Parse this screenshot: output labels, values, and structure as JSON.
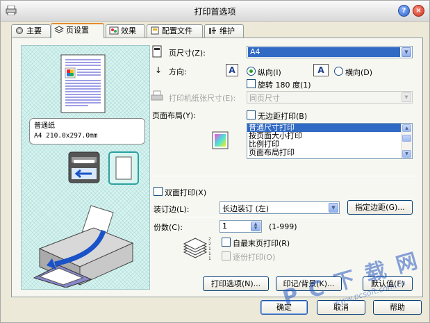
{
  "window": {
    "title": "打印首选项",
    "help_glyph": "?",
    "close_glyph": "×"
  },
  "tabs": [
    {
      "label": "主要",
      "active": false
    },
    {
      "label": "页设置",
      "active": true
    },
    {
      "label": "效果",
      "active": false
    },
    {
      "label": "配置文件",
      "active": false
    },
    {
      "label": "维护",
      "active": false
    }
  ],
  "preview": {
    "paper_name": "普通纸",
    "paper_size": "A4 210.0x297.0mm"
  },
  "page_size": {
    "label": "页尺寸(Z):",
    "value": "A4"
  },
  "orientation": {
    "label": "方向:",
    "portrait_label": "纵向(I)",
    "landscape_label": "横向(D)",
    "selected": "portrait",
    "rotate_label": "旋转 180 度(1)"
  },
  "printer_paper_size": {
    "label": "打印机纸张尺寸(E):",
    "value": "同页尺寸"
  },
  "page_layout": {
    "label": "页面布局(Y):",
    "borderless_label": "无边距打印(B)",
    "options": [
      "普通尺寸打印",
      "按页面大小打印",
      "比例打印",
      "页面布局打印"
    ],
    "selected_index": 0
  },
  "duplex": {
    "label": "双面打印(X)"
  },
  "binding": {
    "label": "装订边(L):",
    "value": "长边装订 (左)",
    "margin_button": "指定边距(G)..."
  },
  "copies": {
    "label": "份数(C):",
    "value": "1",
    "range": "(1-999)",
    "reverse_label": "自最末页打印(R)",
    "collate_label": "逐份打印(O)"
  },
  "panel_buttons": {
    "print_options": "打印选项(N)...",
    "stamp_background": "印记/背景(K)...",
    "defaults": "默认值(F)"
  },
  "dialog_buttons": {
    "ok": "确定",
    "cancel": "取消",
    "help": "帮助"
  },
  "watermark": {
    "main": "P C 下 载 网",
    "url": "www.pcsoft.com.cn"
  },
  "colors": {
    "selection": "#316ac5",
    "accent_tab": "#e68b2c",
    "preview_bg": "#d8f4f0"
  }
}
